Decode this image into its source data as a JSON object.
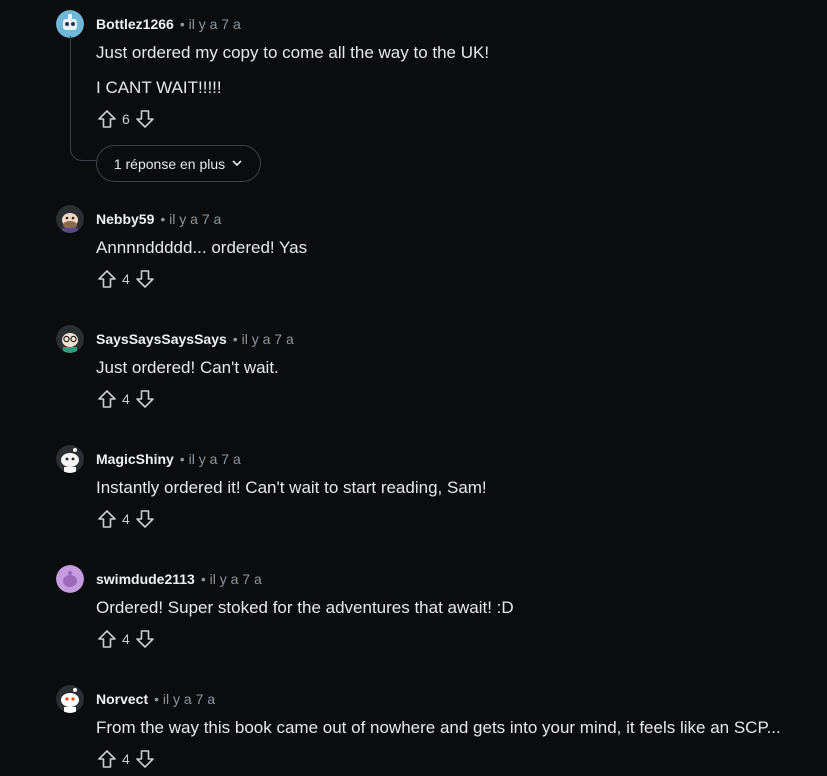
{
  "comments": [
    {
      "username": "Bottlez1266",
      "meta": "• il y a 7 a",
      "lines": [
        "Just ordered my copy to come all the way to the UK!",
        "I CANT WAIT!!!!!"
      ],
      "votes": "6",
      "avatar_icon": "robot-avatar",
      "more_replies": "1 réponse en plus"
    },
    {
      "username": "Nebby59",
      "meta": "• il y a 7 a",
      "lines": [
        "Annnnddddd... ordered! Yas"
      ],
      "votes": "4",
      "avatar_icon": "snoo-avatar-beard"
    },
    {
      "username": "SaysSaysSaysSays",
      "meta": "• il y a 7 a",
      "lines": [
        "Just ordered! Can't wait."
      ],
      "votes": "4",
      "avatar_icon": "snoo-avatar-glasses"
    },
    {
      "username": "MagicShiny",
      "meta": "• il y a 7 a",
      "lines": [
        "Instantly ordered it! Can't wait to start reading, Sam!"
      ],
      "votes": "4",
      "avatar_icon": "snoo-avatar-white"
    },
    {
      "username": "swimdude2113",
      "meta": "• il y a 7 a",
      "lines": [
        "Ordered! Super stoked for the adventures that await! :D"
      ],
      "votes": "4",
      "avatar_icon": "default-avatar-purple"
    },
    {
      "username": "Norvect",
      "meta": "• il y a 7 a",
      "lines": [
        "From the way this book came out of nowhere and gets into your mind, it feels like an SCP..."
      ],
      "votes": "4",
      "avatar_icon": "snoo-avatar-default"
    }
  ],
  "colors": {
    "background": "#0b0c0e",
    "text": "#e6e9eb",
    "meta": "#8b97a0",
    "border": "#3b4247"
  }
}
